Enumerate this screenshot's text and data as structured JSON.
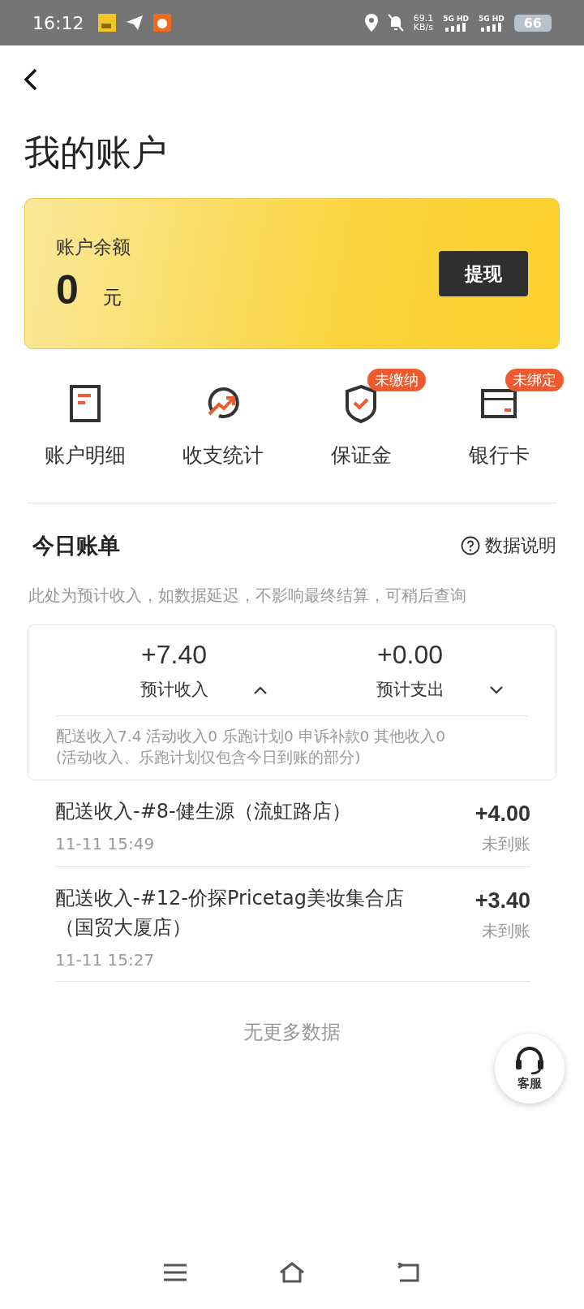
{
  "status_bar": {
    "time": "16:12",
    "net_speed": "69.1",
    "net_unit": "KB/s",
    "sim_labels": [
      "5G HD",
      "5G HD"
    ],
    "battery": "66"
  },
  "page": {
    "title": "我的账户"
  },
  "balance": {
    "label": "账户余额",
    "amount": "0",
    "unit": "元",
    "button": "提现"
  },
  "shortcuts": [
    {
      "kind": "detail",
      "label": "账户明细"
    },
    {
      "kind": "stats",
      "label": "收支统计"
    },
    {
      "kind": "deposit",
      "label": "保证金",
      "badge": "未缴纳"
    },
    {
      "kind": "card",
      "label": "银行卡",
      "badge": "未绑定"
    }
  ],
  "bill": {
    "title": "今日账单",
    "help": "数据说明",
    "note": "此处为预计收入，如数据延迟，不影响最终结算，可稍后查询",
    "totals": [
      {
        "amount": "+7.40",
        "label": "预计收入",
        "expanded": true
      },
      {
        "amount": "+0.00",
        "label": "预计支出",
        "expanded": false
      }
    ],
    "breakdown": [
      "配送收入7.4 活动收入0 乐跑计划0 申诉补款0 其他收入0",
      "(活动收入、乐跑计划仅包含今日到账的部分)"
    ],
    "records": [
      {
        "title": "配送收入-#8-健生源（流虹路店）",
        "time": "11-11 15:49",
        "amount": "+4.00",
        "status": "未到账"
      },
      {
        "title": "配送收入-#12-价探Pricetag美妆集合店（国贸大厦店）",
        "time": "11-11 15:27",
        "amount": "+3.40",
        "status": "未到账"
      }
    ],
    "end_text": "无更多数据"
  },
  "service_button": {
    "label": "客服"
  }
}
